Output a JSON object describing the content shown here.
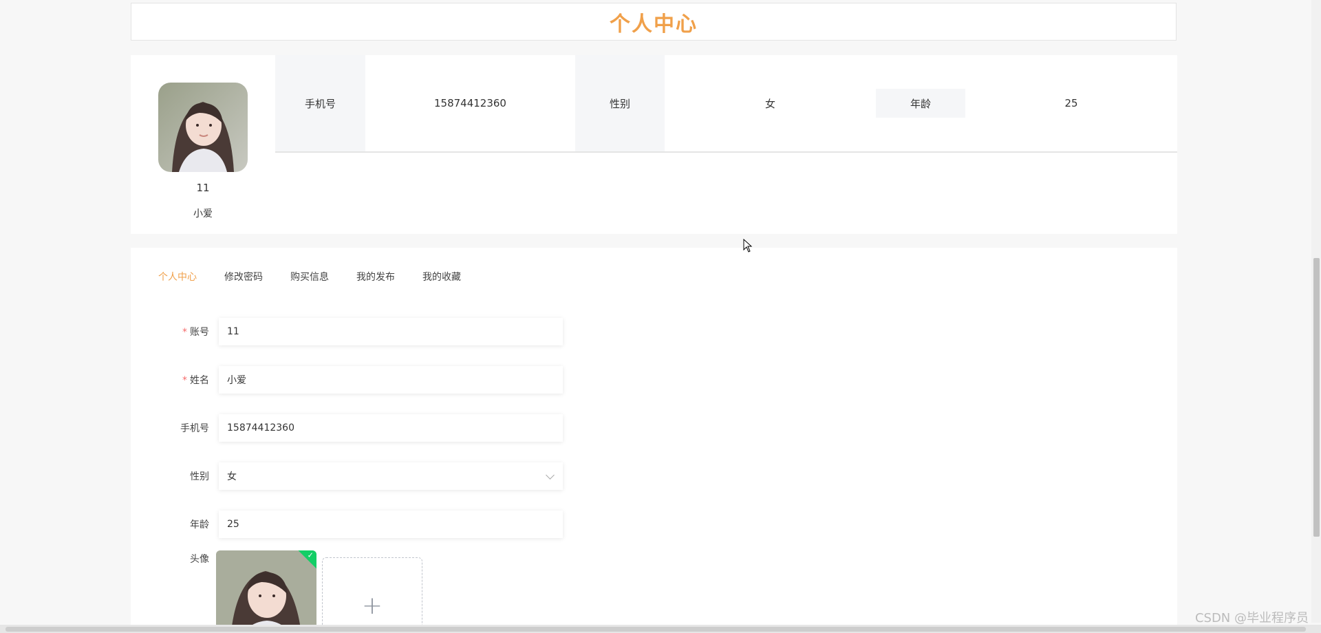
{
  "header": {
    "title": "个人中心"
  },
  "profile": {
    "account": "11",
    "name": "小爱",
    "info": [
      {
        "label": "手机号",
        "value": "15874412360"
      },
      {
        "label": "性别",
        "value": "女"
      },
      {
        "label": "年龄",
        "value": "25"
      }
    ]
  },
  "tabs": [
    "个人中心",
    "修改密码",
    "购买信息",
    "我的发布",
    "我的收藏"
  ],
  "active_tab": "个人中心",
  "form": {
    "account": {
      "label": "账号",
      "value": "11",
      "required": true
    },
    "name": {
      "label": "姓名",
      "value": "小爱",
      "required": true
    },
    "phone": {
      "label": "手机号",
      "value": "15874412360"
    },
    "gender": {
      "label": "性别",
      "value": "女"
    },
    "age": {
      "label": "年龄",
      "value": "25"
    },
    "avatar": {
      "label": "头像",
      "add_symbol": "+"
    }
  },
  "watermark": "CSDN @毕业程序员",
  "colors": {
    "accent": "#f0a04a",
    "required": "#f56c6c",
    "success": "#13ce66"
  }
}
